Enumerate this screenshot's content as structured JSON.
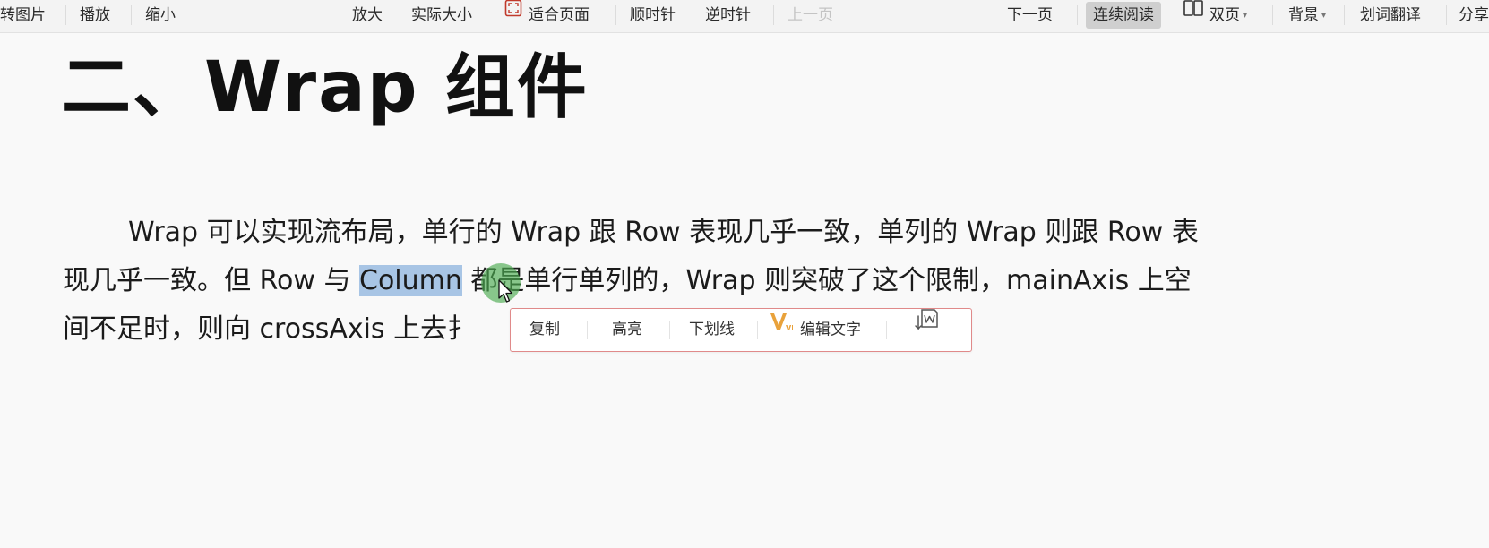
{
  "toolbar": {
    "items": {
      "to_image": "转图片",
      "play": "播放",
      "zoom_out": "缩小",
      "zoom_in": "放大",
      "actual_size": "实际大小",
      "fit_page": "适合页面",
      "rotate_cw": "顺时针",
      "rotate_ccw": "逆时针",
      "prev_page": "上一页",
      "next_page": "下一页",
      "continuous_read": "连续阅读",
      "double_page": "双页",
      "background": "背景",
      "translate": "划词翻译",
      "share": "分享"
    },
    "icons": {
      "fit_page": "fit-page-icon",
      "double_page": "double-page-icon"
    },
    "state": {
      "prev_page_enabled": false,
      "continuous_read_active": true
    }
  },
  "document": {
    "heading": "二、Wrap 组件",
    "paragraph": {
      "line1": "Wrap 可以实现流布局，单行的 Wrap 跟 Row 表现几乎一致，单列的 Wrap 则跟 Row 表",
      "line2_before": "现几乎一致。但 Row 与 ",
      "line2_selected": "Column",
      "line2_after": " 都是单行单列的，Wrap 则突破了这个限制，mainAxis 上空",
      "line3": "间不足时，则向 crossAxis 上去扌"
    }
  },
  "context_menu": {
    "copy": "复制",
    "highlight": "高亮",
    "underline": "下划线",
    "vip_badge": "VIP",
    "edit_text": "编辑文字",
    "icons": {
      "vip": "vip-icon",
      "extract": "extract-text-icon"
    }
  },
  "colors": {
    "selection": "#a8c5e5",
    "active_button": "#cfcfcf",
    "context_border": "#e08a8a",
    "vip_orange": "#e9a23b",
    "cursor_halo": "#4caa50"
  }
}
